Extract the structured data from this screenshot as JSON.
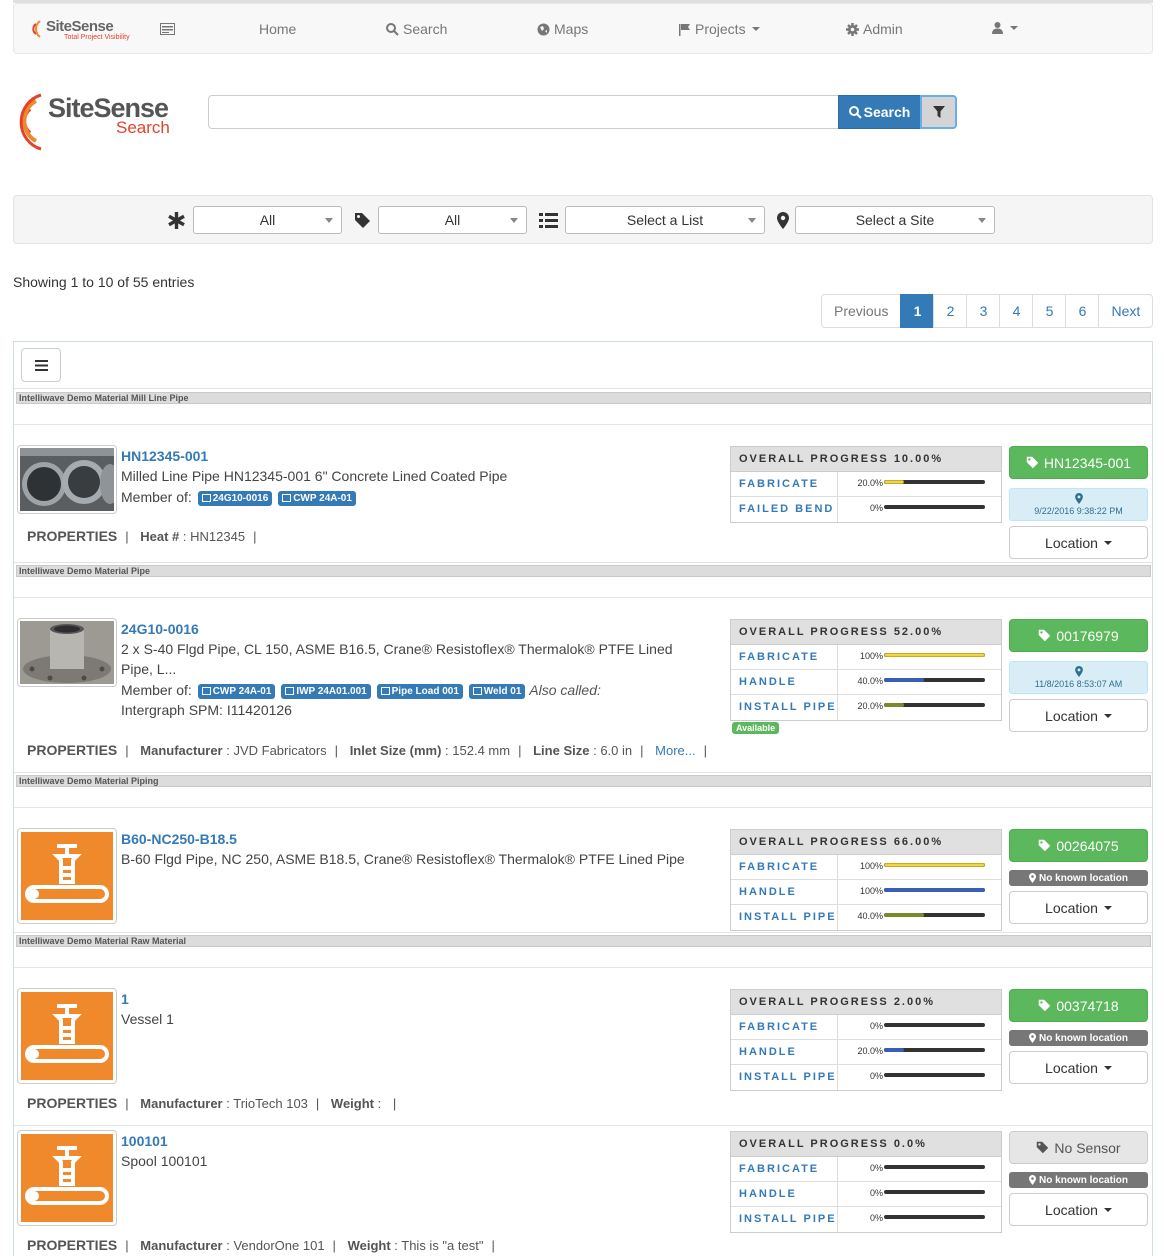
{
  "nav": {
    "brand": "SiteSense",
    "brand_tagline": "Total Project Visibility",
    "items": [
      {
        "label": "Home"
      },
      {
        "label": "Search"
      },
      {
        "label": "Maps"
      },
      {
        "label": "Projects"
      },
      {
        "label": "Admin"
      }
    ]
  },
  "header": {
    "brand_title": "SiteSense",
    "brand_sub": "Search",
    "search_value": "",
    "search_button": "Search"
  },
  "filters": [
    {
      "value": "All"
    },
    {
      "value": "All"
    },
    {
      "value": "Select a List"
    },
    {
      "value": "Select a Site"
    }
  ],
  "showing": "Showing 1 to 10 of 55 entries",
  "pagination": [
    "Previous",
    "1",
    "2",
    "3",
    "4",
    "5",
    "6",
    "Next"
  ],
  "groups": [
    "Intelliwave Demo Material Mill Line Pipe",
    "Intelliwave Demo Material Pipe",
    "Intelliwave Demo Material Piping",
    "Intelliwave Demo Material Raw Material"
  ],
  "items": [
    {
      "id": "HN12345-001",
      "desc": "Milled Line Pipe HN12345-001 6\" Concrete Lined Coated Pipe",
      "member_of_label": "Member of:",
      "tags": [
        "24G10-0016",
        "CWP 24A-01"
      ],
      "props_label": "PROPERTIES",
      "props": [
        {
          "k": "Heat #",
          "v": "HN12345"
        }
      ],
      "overall": "OVERALL PROGRESS 10.00%",
      "steps": [
        {
          "name": "FABRICATE",
          "value": "20.0%",
          "pct": 20,
          "color": "yellow"
        },
        {
          "name": "FAILED BEND",
          "value": "0%",
          "pct": 0,
          "color": "yellow"
        }
      ],
      "tag_button": "HN12345-001",
      "loc_time": "9/22/2016 9:38:22 PM",
      "location_button": "Location"
    },
    {
      "id": "24G10-0016",
      "desc": "2 x S-40 Flgd Pipe, CL 150, ASME B16.5, Crane® Resistoflex® Thermalok® PTFE Lined Pipe, L...",
      "member_of_label": "Member of:",
      "tags": [
        "CWP 24A-01",
        "IWP 24A01.001",
        "Pipe Load 001",
        "Weld 01"
      ],
      "also_called_label": "Also called:",
      "also_called": "Intergraph SPM: I11420126",
      "props_label": "PROPERTIES",
      "props": [
        {
          "k": "Manufacturer",
          "v": "JVD Fabricators"
        },
        {
          "k": "Inlet Size (mm)",
          "v": "152.4 mm"
        },
        {
          "k": "Line Size",
          "v": "6.0 in"
        }
      ],
      "more": "More...",
      "overall": "OVERALL PROGRESS 52.00%",
      "steps": [
        {
          "name": "FABRICATE",
          "value": "100%",
          "pct": 100,
          "color": "yellow"
        },
        {
          "name": "HANDLE",
          "value": "40.0%",
          "pct": 40,
          "color": "blue"
        },
        {
          "name": "INSTALL PIPE",
          "value": "20.0%",
          "pct": 20,
          "color": "olive"
        }
      ],
      "status_badge": "Available",
      "tag_button": "00176979",
      "loc_time": "11/8/2016 8:53:07 AM",
      "location_button": "Location"
    },
    {
      "id": "B60-NC250-B18.5",
      "desc": "B-60 Flgd Pipe, NC 250, ASME B18.5, Crane® Resistoflex® Thermalok® PTFE Lined Pipe",
      "overall": "OVERALL PROGRESS 66.00%",
      "steps": [
        {
          "name": "FABRICATE",
          "value": "100%",
          "pct": 100,
          "color": "yellow"
        },
        {
          "name": "HANDLE",
          "value": "100%",
          "pct": 100,
          "color": "blue"
        },
        {
          "name": "INSTALL PIPE",
          "value": "40.0%",
          "pct": 40,
          "color": "olive"
        }
      ],
      "tag_button": "00264075",
      "no_location": "No known location",
      "location_button": "Location"
    },
    {
      "id": "1",
      "desc": "Vessel 1",
      "props_label": "PROPERTIES",
      "props": [
        {
          "k": "Manufacturer",
          "v": "TrioTech 103"
        },
        {
          "k": "Weight",
          "v": ""
        }
      ],
      "overall": "OVERALL PROGRESS 2.00%",
      "steps": [
        {
          "name": "FABRICATE",
          "value": "0%",
          "pct": 0,
          "color": "yellow"
        },
        {
          "name": "HANDLE",
          "value": "20.0%",
          "pct": 20,
          "color": "blue"
        },
        {
          "name": "INSTALL PIPE",
          "value": "0%",
          "pct": 0,
          "color": "olive"
        }
      ],
      "tag_button": "00374718",
      "no_location": "No known location",
      "location_button": "Location"
    },
    {
      "id": "100101",
      "desc": "Spool 100101",
      "props_label": "PROPERTIES",
      "props": [
        {
          "k": "Manufacturer",
          "v": "VendorOne 101"
        },
        {
          "k": "Weight",
          "v": "This is \"a test\""
        }
      ],
      "overall": "OVERALL PROGRESS 0.0%",
      "steps": [
        {
          "name": "FABRICATE",
          "value": "0%",
          "pct": 0,
          "color": "yellow"
        },
        {
          "name": "HANDLE",
          "value": "0%",
          "pct": 0,
          "color": "blue"
        },
        {
          "name": "INSTALL PIPE",
          "value": "0%",
          "pct": 0,
          "color": "olive"
        }
      ],
      "tag_button": "No Sensor",
      "no_location": "No known location",
      "location_button": "Location"
    }
  ],
  "colors": {
    "primary": "#337ab7",
    "success": "#5cb85c",
    "brand_red": "#e2432b",
    "icon_orange": "#f0892b"
  }
}
